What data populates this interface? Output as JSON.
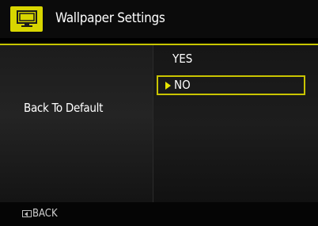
{
  "header": {
    "title": "Wallpaper Settings",
    "icon": "wallpaper-icon",
    "icon_color": "#d8d600"
  },
  "setting": {
    "label": "Back To Default"
  },
  "options": [
    {
      "label": "YES",
      "selected": false
    },
    {
      "label": "NO",
      "selected": true
    }
  ],
  "selection_pointer_icon": "right-triangle-icon",
  "footer": {
    "back_label": "BACK",
    "back_icon": "back-button-icon"
  },
  "colors": {
    "accent": "#c9c400",
    "background": "#000000",
    "text": "#ffffff"
  }
}
